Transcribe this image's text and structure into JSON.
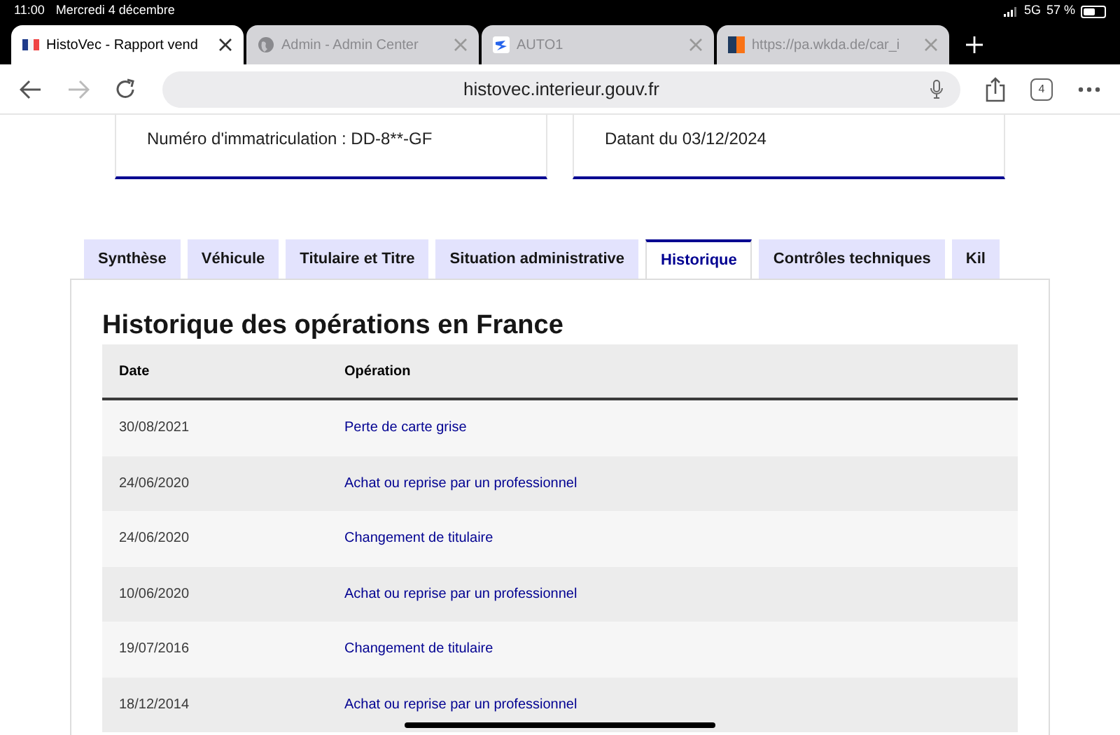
{
  "status_bar": {
    "time": "11:00",
    "date": "Mercredi 4 décembre",
    "network": "5G",
    "battery_text": "57 %"
  },
  "browser_tabs": [
    {
      "title": "HistoVec - Rapport vend",
      "selected": true
    },
    {
      "title": "Admin - Admin Center",
      "selected": false
    },
    {
      "title": "AUTO1",
      "selected": false
    },
    {
      "title": "https://pa.wkda.de/car_i",
      "selected": false
    }
  ],
  "toolbar": {
    "url": "histovec.interieur.gouv.fr",
    "tab_count": "4"
  },
  "cards": [
    {
      "text": "Numéro d'immatriculation : DD-8**-GF"
    },
    {
      "text": "Datant du 03/12/2024"
    }
  ],
  "page_tabs": [
    {
      "label": "Synthèse",
      "selected": false
    },
    {
      "label": "Véhicule",
      "selected": false
    },
    {
      "label": "Titulaire et Titre",
      "selected": false
    },
    {
      "label": "Situation administrative",
      "selected": false
    },
    {
      "label": "Historique",
      "selected": true
    },
    {
      "label": "Contrôles techniques",
      "selected": false
    },
    {
      "label": "Kil",
      "selected": false
    }
  ],
  "section_title": "Historique des opérations en France",
  "table": {
    "columns": [
      "Date",
      "Opération"
    ],
    "rows": [
      [
        "30/08/2021",
        "Perte de carte grise"
      ],
      [
        "24/06/2020",
        "Achat ou reprise par un professionnel"
      ],
      [
        "24/06/2020",
        "Changement de titulaire"
      ],
      [
        "10/06/2020",
        "Achat ou reprise par un professionnel"
      ],
      [
        "19/07/2016",
        "Changement de titulaire"
      ],
      [
        "18/12/2014",
        "Achat ou reprise par un professionnel"
      ]
    ]
  }
}
